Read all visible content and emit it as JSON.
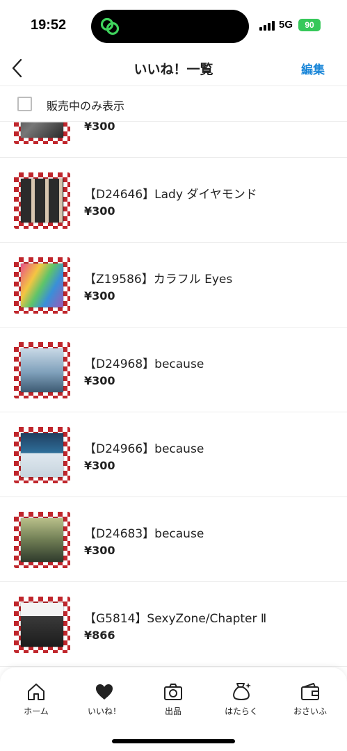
{
  "status_bar": {
    "time": "19:52",
    "network": "5G",
    "battery": "90"
  },
  "header": {
    "title": "いいね！一覧",
    "edit_label": "編集"
  },
  "filter": {
    "label": "販売中のみ表示",
    "checked": false
  },
  "items": [
    {
      "title": "",
      "price": "¥300"
    },
    {
      "title": "【D24646】Lady ダイヤモンド",
      "price": "¥300"
    },
    {
      "title": "【Z19586】カラフル Eyes",
      "price": "¥300"
    },
    {
      "title": "【D24968】because",
      "price": "¥300"
    },
    {
      "title": "【D24966】because",
      "price": "¥300"
    },
    {
      "title": "【D24683】because",
      "price": "¥300"
    },
    {
      "title": "【G5814】SexyZone/Chapter Ⅱ",
      "price": "¥866"
    }
  ],
  "tabbar": {
    "tabs": [
      {
        "label": "ホーム",
        "icon": "home-icon"
      },
      {
        "label": "いいね！",
        "icon": "heart-icon"
      },
      {
        "label": "出品",
        "icon": "camera-icon"
      },
      {
        "label": "はたらく",
        "icon": "money-bag-icon"
      },
      {
        "label": "おさいふ",
        "icon": "wallet-icon"
      }
    ]
  },
  "colors": {
    "accent": "#1a86d8",
    "battery": "#36c85a",
    "thumb_check": "#c0262c"
  }
}
